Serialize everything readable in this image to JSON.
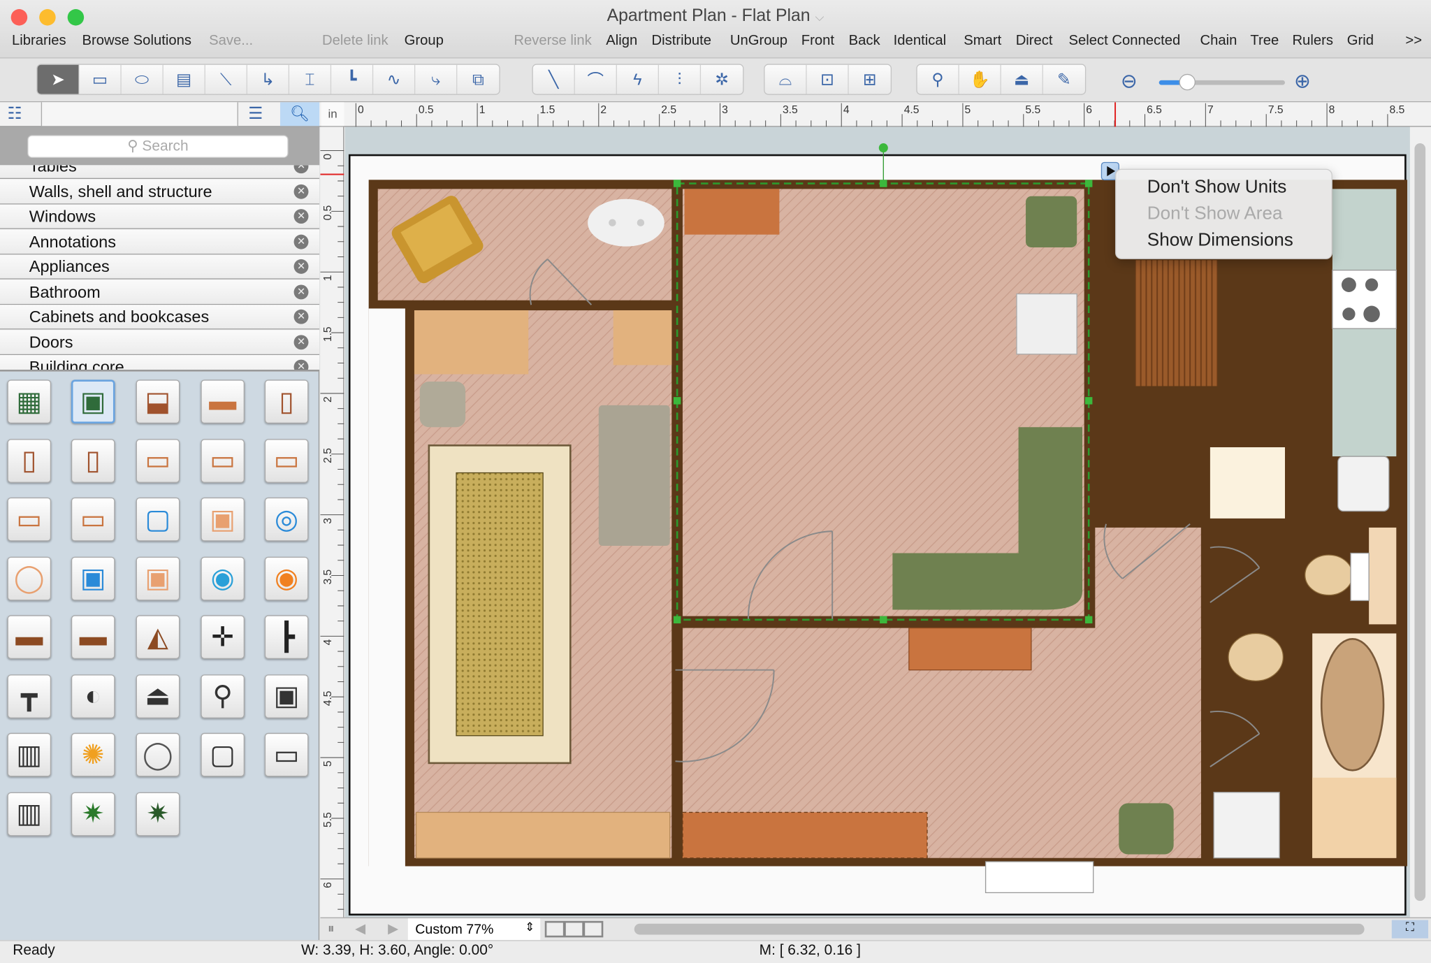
{
  "window": {
    "title": "Apartment Plan - Flat Plan",
    "traffic_lights": {
      "close": "#fc5f57",
      "minimize": "#fdbc2e",
      "zoom": "#33c748"
    }
  },
  "menu": {
    "items": [
      {
        "label": "Libraries",
        "enabled": true
      },
      {
        "label": "Browse Solutions",
        "enabled": true
      },
      {
        "label": "Save...",
        "enabled": false
      },
      {
        "label": "Delete link",
        "enabled": false
      },
      {
        "label": "Group",
        "enabled": true
      },
      {
        "label": "Reverse link",
        "enabled": false
      },
      {
        "label": "Align",
        "enabled": true
      },
      {
        "label": "Distribute",
        "enabled": true
      },
      {
        "label": "UnGroup",
        "enabled": true
      },
      {
        "label": "Front",
        "enabled": true
      },
      {
        "label": "Back",
        "enabled": true
      },
      {
        "label": "Identical",
        "enabled": true
      },
      {
        "label": "Smart",
        "enabled": true
      },
      {
        "label": "Direct",
        "enabled": true
      },
      {
        "label": "Select Connected",
        "enabled": true
      },
      {
        "label": "Chain",
        "enabled": true
      },
      {
        "label": "Tree",
        "enabled": true
      },
      {
        "label": "Rulers",
        "enabled": true
      },
      {
        "label": "Grid",
        "enabled": true
      }
    ],
    "overflow": ">>"
  },
  "toolbar": {
    "group1": [
      "pointer-icon",
      "rectangle-icon",
      "ellipse-icon",
      "text-box-icon",
      "connector-direct-icon",
      "connector-arc-icon",
      "connector-smart-icon",
      "connector-orthogonal-icon",
      "connector-curve-icon",
      "connector-round-icon",
      "insert-icon"
    ],
    "group2": [
      "line-icon",
      "arc-icon",
      "bezier-icon",
      "spline-icon",
      "polyline-icon"
    ],
    "group3": [
      "edit-points-icon",
      "resize-icon",
      "group-edit-icon"
    ],
    "group4": [
      "zoom-icon",
      "hand-icon",
      "stamp-icon",
      "eyedropper-icon"
    ],
    "zoom_slider": {
      "value_percent": 22,
      "accent": "#3d8ee8"
    }
  },
  "ruler": {
    "unit": "in",
    "h_ticks": [
      "0",
      "0.5",
      "1",
      "1.5",
      "2",
      "2.5",
      "3",
      "3.5",
      "4",
      "4.5",
      "5",
      "5.5",
      "6",
      "6.5",
      "7",
      "7.5",
      "8",
      "8.5"
    ],
    "v_ticks": [
      "0",
      "0.5",
      "1",
      "1.5",
      "2",
      "2.5",
      "3",
      "3.5",
      "4",
      "4.5",
      "5",
      "5.5",
      "6"
    ],
    "marker_color": "#e02020"
  },
  "library": {
    "search_placeholder": "Search",
    "items": [
      "Tables",
      "Walls, shell and structure",
      "Windows",
      "Annotations",
      "Appliances",
      "Bathroom",
      "Cabinets and bookcases",
      "Doors",
      "Building core"
    ]
  },
  "popup_menu": {
    "items": [
      {
        "label": "Don't Show Units",
        "enabled": true
      },
      {
        "label": "Don't Show Area",
        "enabled": false
      },
      {
        "label": "Show Dimensions",
        "enabled": true
      }
    ]
  },
  "bottom": {
    "zoom_label": "Custom 77%"
  },
  "status": {
    "state": "Ready",
    "dimensions": "W: 3.39,  H: 3.60,  Angle: 0.00°",
    "mouse": "M: [ 6.32, 0.16 ]"
  },
  "colors": {
    "wall": "#5b3818",
    "floor": "#d8b3a2",
    "kitchen_floor": "#dde7ea",
    "selection": "#2d9a2d",
    "sofa": "#6f8150",
    "wood": "#c9743f"
  }
}
